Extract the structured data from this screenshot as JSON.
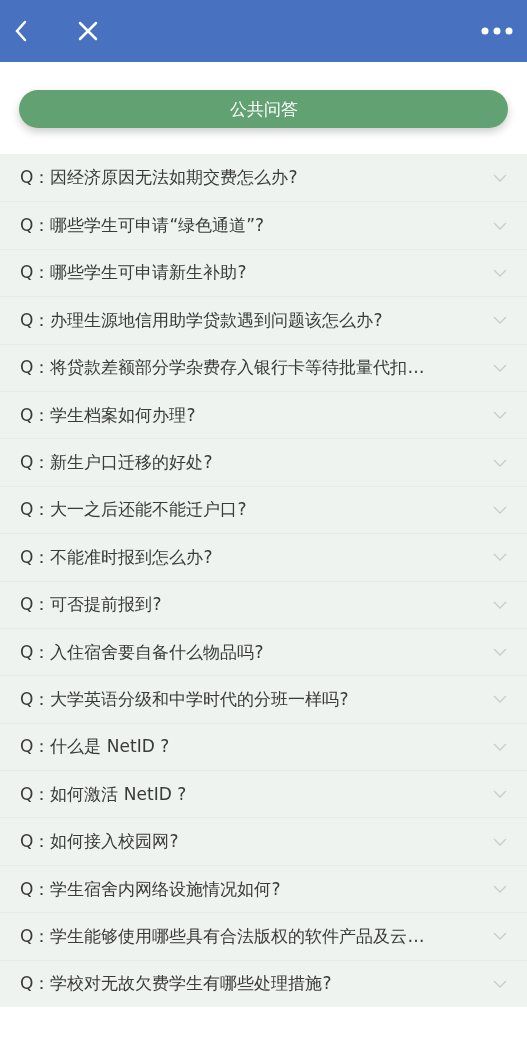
{
  "header_button": {
    "label": "公共问答"
  },
  "questions": [
    {
      "text": "Q：因经济原因无法如期交费怎么办?",
      "expanded": false
    },
    {
      "text": "Q：哪些学生可申请“绿色通道”?",
      "expanded": false
    },
    {
      "text": "Q：哪些学生可申请新生补助?",
      "expanded": false
    },
    {
      "text": "Q：办理生源地信用助学贷款遇到问题该怎么办?",
      "expanded": false
    },
    {
      "text": "Q：将贷款差额部分学杂费存入银行卡等待批量代扣…",
      "expanded": false
    },
    {
      "text": "Q：学生档案如何办理?",
      "expanded": false
    },
    {
      "text": "Q：新生户口迁移的好处?",
      "expanded": false
    },
    {
      "text": "Q：大一之后还能不能迁户口?",
      "expanded": false
    },
    {
      "text": "Q：不能准时报到怎么办?",
      "expanded": false
    },
    {
      "text": "Q：可否提前报到?",
      "expanded": false
    },
    {
      "text": "Q：入住宿舍要自备什么物品吗?",
      "expanded": false
    },
    {
      "text": "Q：大学英语分级和中学时代的分班一样吗?",
      "expanded": false
    },
    {
      "text": "Q：什么是 NetID ?",
      "expanded": false
    },
    {
      "text": "Q：如何激活 NetID ?",
      "expanded": false
    },
    {
      "text": "Q：如何接入校园网?",
      "expanded": false
    },
    {
      "text": "Q：学生宿舍内网络设施情况如何?",
      "expanded": false
    },
    {
      "text": "Q：学生能够使用哪些具有合法版权的软件产品及云…",
      "expanded": false
    },
    {
      "text": "Q：学校对无故欠费学生有哪些处理措施?",
      "expanded": false
    }
  ]
}
